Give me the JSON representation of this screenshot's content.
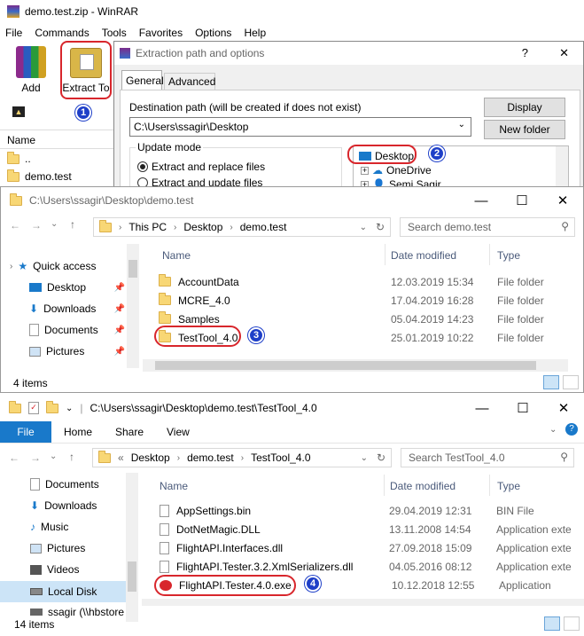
{
  "winrar": {
    "title": "demo.test.zip - WinRAR",
    "menu": [
      "File",
      "Commands",
      "Tools",
      "Favorites",
      "Options",
      "Help"
    ],
    "toolbar": {
      "add": "Add",
      "extract": "Extract To"
    },
    "list_header": "Name",
    "items": [
      "..",
      "demo.test"
    ]
  },
  "dialog": {
    "title": "Extraction path and options",
    "help": "?",
    "close": "✕",
    "tabs": [
      "General",
      "Advanced"
    ],
    "dest_label": "Destination path (will be created if does not exist)",
    "dest_value": "C:\\Users\\ssagir\\Desktop",
    "display_btn": "Display",
    "new_folder_btn": "New folder",
    "update_mode_label": "Update mode",
    "opt1": "Extract and replace files",
    "opt2": "Extract and update files",
    "tree": [
      "Desktop",
      "OneDrive",
      "Semi Sagir"
    ]
  },
  "explorer1": {
    "title": "C:\\Users\\ssagir\\Desktop\\demo.test",
    "breadcrumb": [
      "This PC",
      "Desktop",
      "demo.test"
    ],
    "search_placeholder": "Search demo.test",
    "cols": {
      "name": "Name",
      "date": "Date modified",
      "type": "Type"
    },
    "nav": [
      {
        "label": "Quick access"
      },
      {
        "label": "Desktop"
      },
      {
        "label": "Downloads"
      },
      {
        "label": "Documents"
      },
      {
        "label": "Pictures"
      }
    ],
    "rows": [
      {
        "name": "AccountData",
        "date": "12.03.2019 15:34",
        "type": "File folder"
      },
      {
        "name": "MCRE_4.0",
        "date": "17.04.2019 16:28",
        "type": "File folder"
      },
      {
        "name": "Samples",
        "date": "05.04.2019 14:23",
        "type": "File folder"
      },
      {
        "name": "TestTool_4.0",
        "date": "25.01.2019 10:22",
        "type": "File folder"
      }
    ],
    "status": "4 items"
  },
  "explorer2": {
    "title": "C:\\Users\\ssagir\\Desktop\\demo.test\\TestTool_4.0",
    "ribbon_tabs": [
      "File",
      "Home",
      "Share",
      "View"
    ],
    "breadcrumb": [
      "«",
      "Desktop",
      "demo.test",
      "TestTool_4.0"
    ],
    "search_placeholder": "Search TestTool_4.0",
    "cols": {
      "name": "Name",
      "date": "Date modified",
      "type": "Type"
    },
    "nav": [
      {
        "label": "Documents"
      },
      {
        "label": "Downloads"
      },
      {
        "label": "Music"
      },
      {
        "label": "Pictures"
      },
      {
        "label": "Videos"
      },
      {
        "label": "Local Disk"
      },
      {
        "label": "ssagir (\\\\hbstore"
      }
    ],
    "rows": [
      {
        "name": "AppSettings.bin",
        "date": "29.04.2019 12:31",
        "type": "BIN File"
      },
      {
        "name": "DotNetMagic.DLL",
        "date": "13.11.2008 14:54",
        "type": "Application exte"
      },
      {
        "name": "FlightAPI.Interfaces.dll",
        "date": "27.09.2018 15:09",
        "type": "Application exte"
      },
      {
        "name": "FlightAPI.Tester.3.2.XmlSerializers.dll",
        "date": "04.05.2016 08:12",
        "type": "Application exte"
      },
      {
        "name": "FlightAPI.Tester.4.0.exe",
        "date": "10.12.2018 12:55",
        "type": "Application"
      }
    ],
    "status": "14 items"
  },
  "callouts": [
    "1",
    "2",
    "3",
    "4"
  ],
  "colors": {
    "accent": "#1979ca",
    "callout": "#1e3fc8",
    "highlight": "#d8262c"
  }
}
